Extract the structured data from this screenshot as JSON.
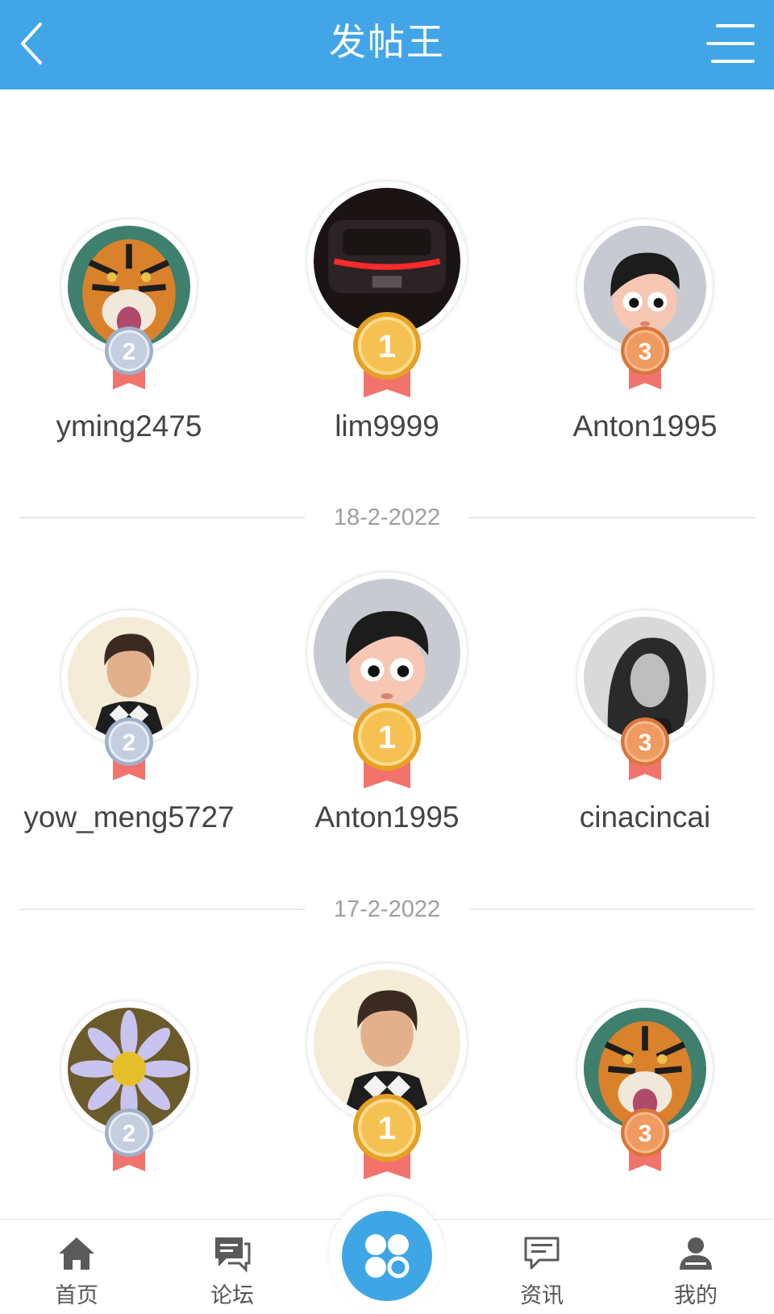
{
  "header": {
    "title": "发帖王"
  },
  "colors": {
    "header_bg": "#42a5e8",
    "gold": "#f4b43c",
    "silver": "#b8c4d6",
    "bronze": "#e98b4e",
    "ribbon": "#f2736c",
    "center_button": "#3fa6e6"
  },
  "sections": [
    {
      "left": {
        "name": "yming2475",
        "rank": "2",
        "avatar": "tiger"
      },
      "mid": {
        "name": "lim9999",
        "rank": "1",
        "avatar": "car-night"
      },
      "right": {
        "name": "Anton1995",
        "rank": "3",
        "avatar": "cartoon-boy"
      },
      "date": "18-2-2022"
    },
    {
      "left": {
        "name": "yow_meng5727",
        "rank": "2",
        "avatar": "retro-man"
      },
      "mid": {
        "name": "Anton1995",
        "rank": "1",
        "avatar": "cartoon-boy"
      },
      "right": {
        "name": "cinacincai",
        "rank": "3",
        "avatar": "woman-bw"
      },
      "date": "17-2-2022"
    },
    {
      "left": {
        "name": "",
        "rank": "2",
        "avatar": "daisy"
      },
      "mid": {
        "name": "",
        "rank": "1",
        "avatar": "retro-man"
      },
      "right": {
        "name": "",
        "rank": "3",
        "avatar": "tiger"
      }
    }
  ],
  "tabbar": {
    "home": {
      "label": "首页",
      "icon": "home-icon"
    },
    "forum": {
      "label": "论坛",
      "icon": "forum-icon"
    },
    "center": {
      "icon": "clover-icon"
    },
    "news": {
      "label": "资讯",
      "icon": "news-icon"
    },
    "me": {
      "label": "我的",
      "icon": "user-icon"
    }
  }
}
